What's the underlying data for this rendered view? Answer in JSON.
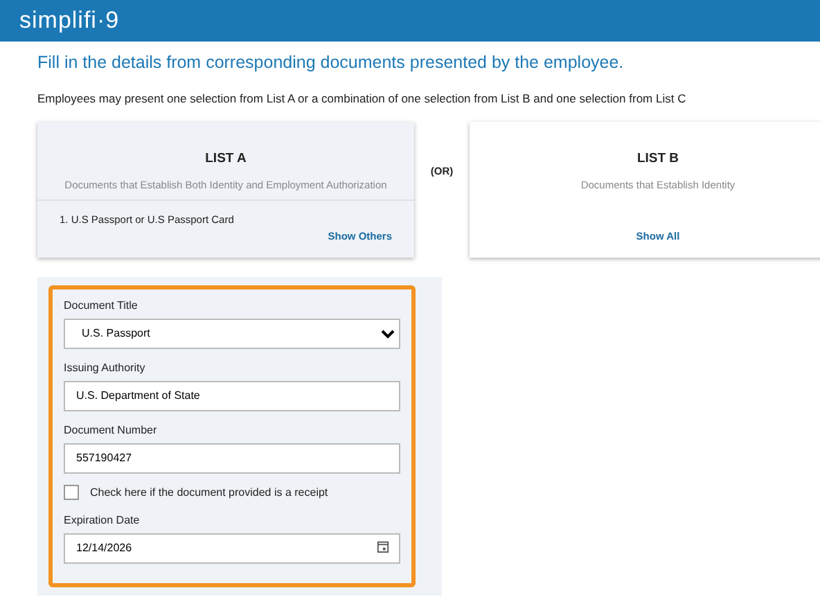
{
  "header": {
    "logo": "simplifi·9"
  },
  "page_title": "Fill in the details from corresponding documents presented by the employee.",
  "instruction": "Employees may present one selection from List A or a combination of one selection from List B and one selection from List C",
  "lists": [
    {
      "title": "LIST A",
      "subtitle": "Documents that Establish Both Identity and Employment Authorization",
      "selected": true,
      "item": "1. U.S Passport or U.S Passport Card",
      "link": "Show Others"
    },
    {
      "title": "LIST B",
      "subtitle": "Documents that Establish Identity",
      "selected": false,
      "link": "Show All"
    }
  ],
  "separator": "(OR)",
  "form": {
    "fields": [
      {
        "kind": "select",
        "label": "Document Title",
        "value": "U.S. Passport"
      },
      {
        "kind": "text",
        "label": "Issuing Authority",
        "value": "U.S. Department of State"
      },
      {
        "kind": "text",
        "label": "Document Number",
        "value": "557190427"
      },
      {
        "kind": "checkbox",
        "label": "Check here if the document provided is a receipt",
        "checked": false
      },
      {
        "kind": "date",
        "label": "Expiration Date",
        "value": "12/14/2026"
      }
    ]
  }
}
